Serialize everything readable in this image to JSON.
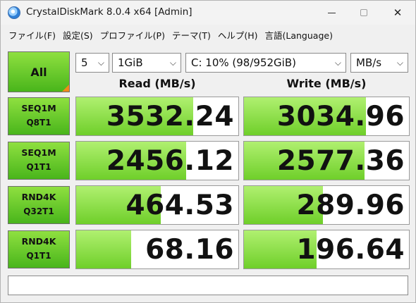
{
  "window": {
    "title": "CrystalDiskMark 8.0.4 x64 [Admin]",
    "close_glyph": "✕"
  },
  "menu": [
    "ファイル(F)",
    "設定(S)",
    "プロファイル(P)",
    "テーマ(T)",
    "ヘルプ(H)",
    "言語(Language)"
  ],
  "controls": {
    "all_label": "All",
    "count": "5",
    "size": "1GiB",
    "drive": "C: 10% (98/952GiB)",
    "unit": "MB/s",
    "chevron": "⌵"
  },
  "headers": {
    "read": "Read (MB/s)",
    "write": "Write (MB/s)"
  },
  "tests": [
    {
      "line1": "SEQ1M",
      "line2": "Q8T1",
      "read": "3532.24",
      "write": "3034.96",
      "read_fill": 0.72,
      "write_fill": 0.74
    },
    {
      "line1": "SEQ1M",
      "line2": "Q1T1",
      "read": "2456.12",
      "write": "2577.36",
      "read_fill": 0.68,
      "write_fill": 0.73
    },
    {
      "line1": "RND4K",
      "line2": "Q32T1",
      "read": "464.53",
      "write": "289.96",
      "read_fill": 0.52,
      "write_fill": 0.48
    },
    {
      "line1": "RND4K",
      "line2": "Q1T1",
      "read": "68.16",
      "write": "196.64",
      "read_fill": 0.34,
      "write_fill": 0.44
    }
  ],
  "colors": {
    "label_green_top": "#8fe040",
    "label_green_bottom": "#49b51b",
    "bar_green": "#6fcf2a",
    "all_corner": "#f08a1c"
  }
}
